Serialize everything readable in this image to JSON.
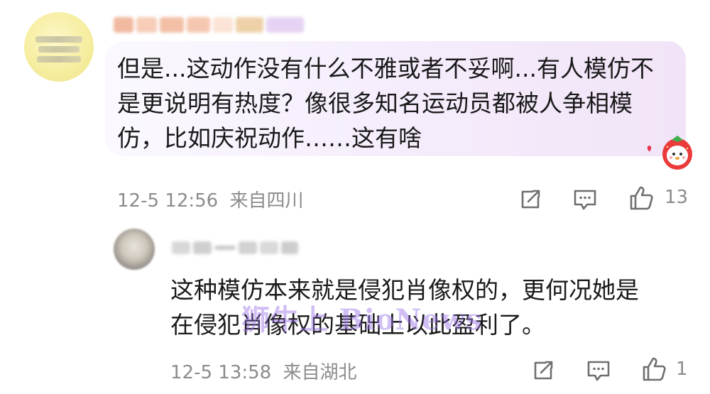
{
  "comments": [
    {
      "text": "但是...这动作没有什么不雅或者不妥啊...有人模仿不\n是更说明有热度？像很多知名运动员都被人争相模\n仿，比如庆祝动作……这有啥",
      "time": "12-5 12:56",
      "location": "来自四川",
      "likes": "13",
      "icons": [
        "share-icon",
        "comment-icon",
        "like-icon"
      ]
    },
    {
      "text": "这种模仿本来就是侵犯肖像权的，更何况她是\n在侵犯肖像权的基础上以此盈利了。",
      "time": "12-5 13:58",
      "location": "来自湖北",
      "likes": "1",
      "icons": [
        "share-icon",
        "comment-icon",
        "like-icon"
      ]
    }
  ],
  "watermark": "狮牛上 BioNews",
  "colors": {
    "bubble_gradient_start": "#fbf9ff",
    "bubble_gradient_end": "#f1e4f8",
    "meta_gray": "#8c8c8c",
    "text": "#1a1a1a",
    "watermark": "#966ee6"
  }
}
